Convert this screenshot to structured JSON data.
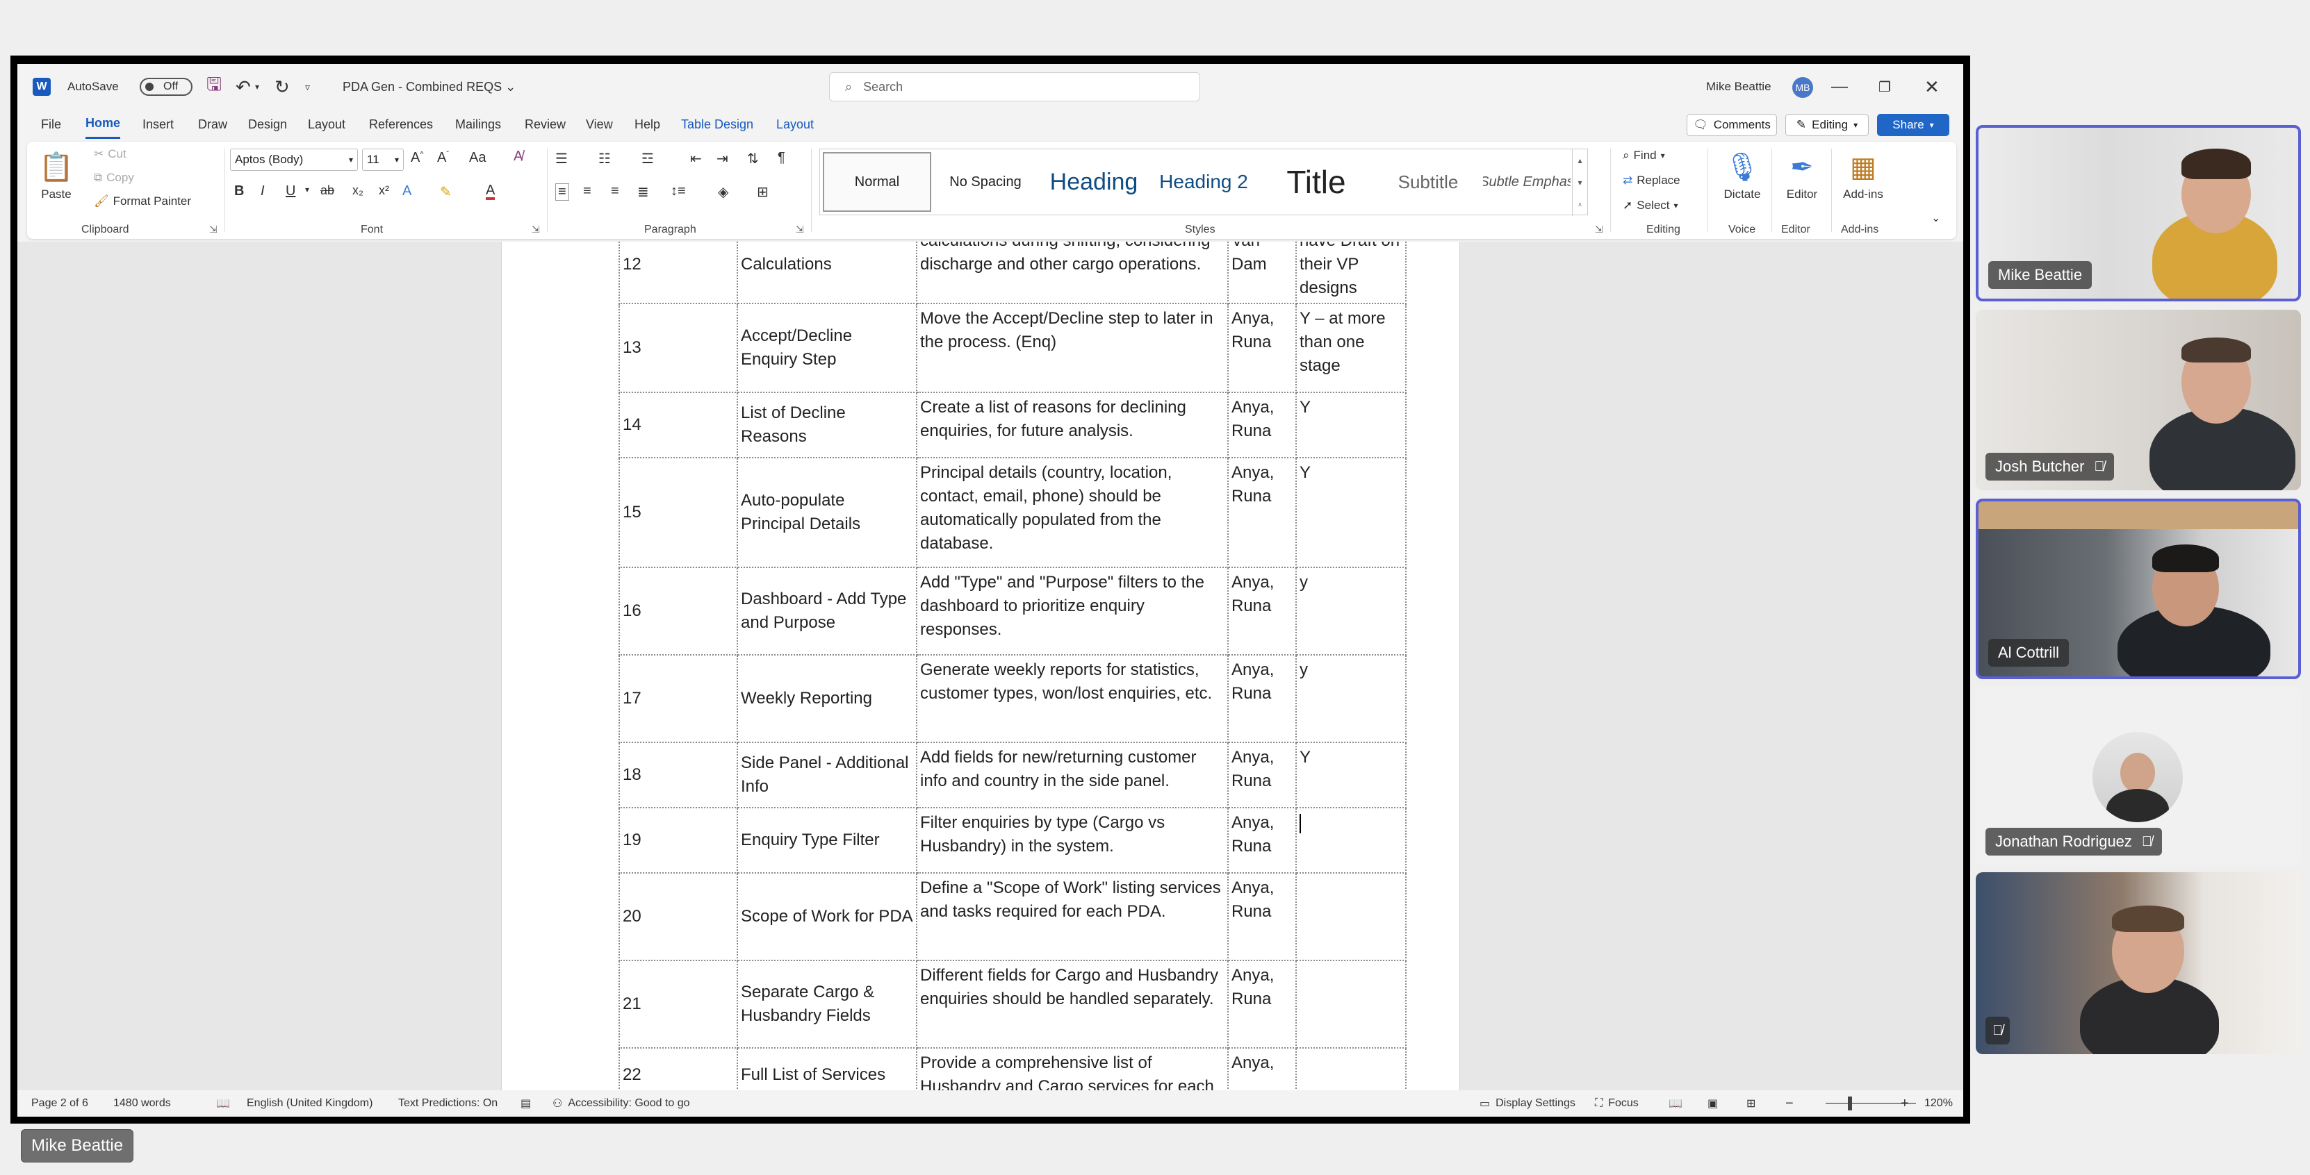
{
  "window": {
    "autosave_label": "AutoSave",
    "autosave_state": "Off",
    "doc_title": "PDA Gen - Combined REQS",
    "doc_title_chevron": "⌄",
    "search_placeholder": "Search",
    "user_name": "Mike Beattie",
    "user_initials": "MB"
  },
  "tabs": [
    "File",
    "Home",
    "Insert",
    "Draw",
    "Design",
    "Layout",
    "References",
    "Mailings",
    "Review",
    "View",
    "Help",
    "Table Design",
    "Layout"
  ],
  "tab_actions": {
    "comments": "Comments",
    "editing": "Editing",
    "share": "Share"
  },
  "ribbon": {
    "clipboard": {
      "label": "Clipboard",
      "paste": "Paste",
      "cut": "Cut",
      "copy": "Copy",
      "format_painter": "Format Painter"
    },
    "font": {
      "label": "Font",
      "font_name": "Aptos (Body)",
      "font_size": "11",
      "bold": "B",
      "italic": "I",
      "underline": "U",
      "strikethrough": "ab",
      "subscript": "x₂",
      "superscript": "x²",
      "change_case": "Aa"
    },
    "paragraph": {
      "label": "Paragraph"
    },
    "styles": {
      "label": "Styles",
      "items": [
        "Normal",
        "No Spacing",
        "Heading",
        "Heading 2",
        "Title",
        "Subtitle",
        "Subtle Emphas"
      ]
    },
    "editing": {
      "label": "Editing",
      "find": "Find",
      "replace": "Replace",
      "select": "Select"
    },
    "voice": {
      "label": "Voice",
      "dictate": "Dictate"
    },
    "editor": {
      "label": "Editor",
      "editor": "Editor"
    },
    "addins": {
      "label": "Add-ins",
      "addins": "Add-ins"
    }
  },
  "table": {
    "rows": [
      {
        "num": "12",
        "name": "Calculations",
        "desc": "calculations during shifting, considering discharge and other cargo operations.",
        "owner": "Van Dam",
        "done": "have Draft on their VP designs"
      },
      {
        "num": "13",
        "name": "Accept/Decline Enquiry Step",
        "desc": "Move the Accept/Decline step to later in the process. (Enq)",
        "owner": "Anya, Runa",
        "done": "Y – at more than one stage"
      },
      {
        "num": "14",
        "name": "List of Decline Reasons",
        "desc": "Create a list of reasons for declining enquiries, for future analysis.",
        "owner": "Anya, Runa",
        "done": "Y"
      },
      {
        "num": "15",
        "name": "Auto-populate Principal Details",
        "desc": "Principal details (country, location, contact, email, phone) should be automatically populated from the database.",
        "owner": "Anya, Runa",
        "done": "Y"
      },
      {
        "num": "16",
        "name": "Dashboard - Add Type and Purpose",
        "desc": "Add \"Type\" and \"Purpose\" filters to the dashboard to prioritize enquiry responses.",
        "owner": "Anya, Runa",
        "done": "y"
      },
      {
        "num": "17",
        "name": "Weekly Reporting",
        "desc": "Generate weekly reports for statistics, customer types, won/lost enquiries, etc.",
        "owner": "Anya, Runa",
        "done": "y"
      },
      {
        "num": "18",
        "name": "Side Panel - Additional Info",
        "desc": "Add fields for new/returning customer info and country in the side panel.",
        "owner": "Anya, Runa",
        "done": "Y"
      },
      {
        "num": "19",
        "name": "Enquiry Type Filter",
        "desc": "Filter enquiries by type (Cargo vs Husbandry) in the system.",
        "owner": "Anya, Runa",
        "done": ""
      },
      {
        "num": "20",
        "name": "Scope of Work for PDA",
        "desc": "Define a \"Scope of Work\" listing services and tasks required for each PDA.",
        "owner": "Anya, Runa",
        "done": ""
      },
      {
        "num": "21",
        "name": "Separate Cargo & Husbandry Fields",
        "desc": "Different fields for Cargo and Husbandry enquiries should be handled separately.",
        "owner": "Anya, Runa",
        "done": ""
      },
      {
        "num": "22",
        "name": "Full List of Services",
        "desc": "Provide a comprehensive list of Husbandry and Cargo services for each",
        "owner": "Anya,",
        "done": ""
      }
    ]
  },
  "status": {
    "page": "Page 2 of 6",
    "words": "1480 words",
    "language": "English (United Kingdom)",
    "predictions": "Text Predictions: On",
    "accessibility": "Accessibility: Good to go",
    "display_settings": "Display Settings",
    "focus": "Focus",
    "zoom": "120%"
  },
  "participants": [
    {
      "name": "Mike Beattie",
      "muted": false,
      "speaking": true
    },
    {
      "name": "Josh Butcher",
      "muted": true,
      "speaking": false
    },
    {
      "name": "Al Cottrill",
      "muted": false,
      "speaking": true
    },
    {
      "name": "Jonathan Rodriguez",
      "muted": true,
      "speaking": false
    },
    {
      "name": "",
      "muted": true,
      "speaking": false
    }
  ],
  "presenter": "Mike Beattie",
  "colors": {
    "word_blue": "#185abd",
    "share_blue": "#1f66c7",
    "speaking_border": "#5a5fd1"
  }
}
